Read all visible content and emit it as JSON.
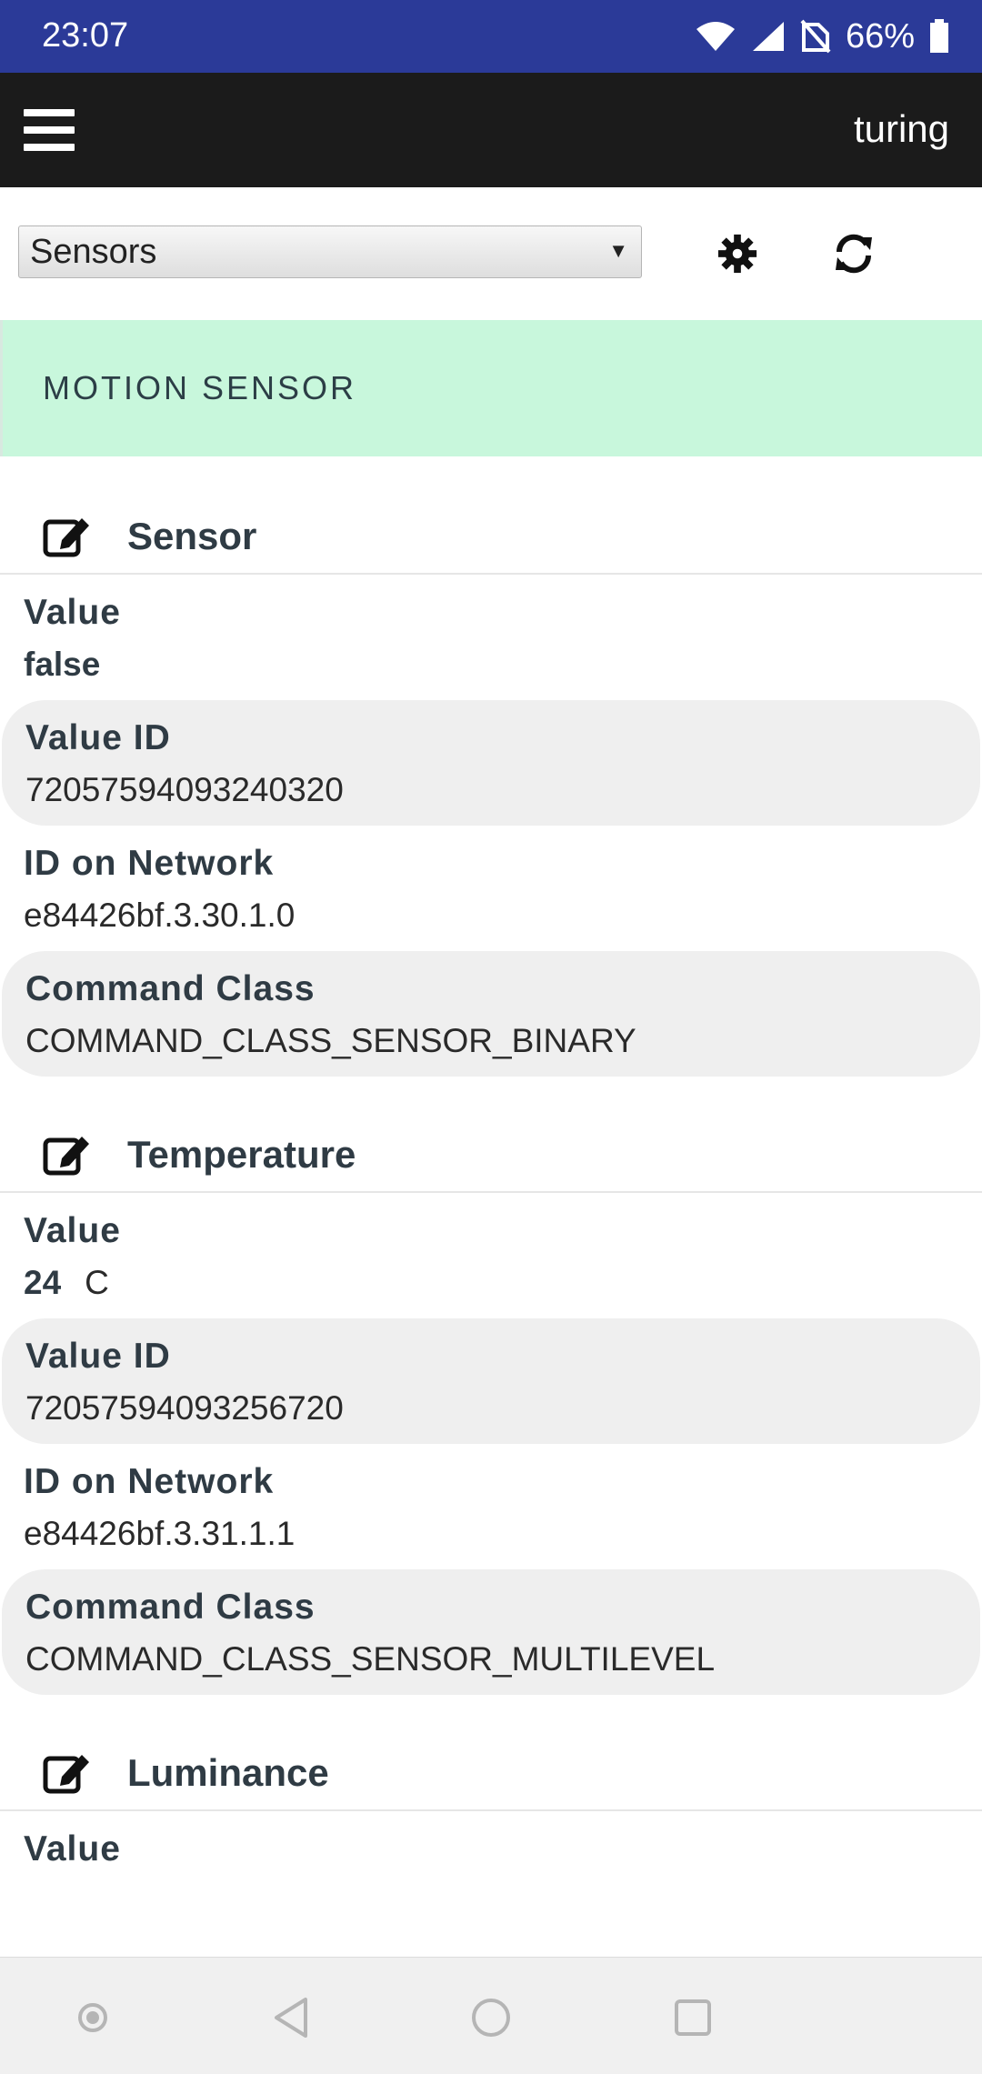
{
  "status_bar": {
    "time": "23:07",
    "battery": "66%"
  },
  "app_bar": {
    "title": "turing"
  },
  "toolbar": {
    "select_value": "Sensors",
    "select_arrow": "▼",
    "settings_icon": "gear-icon",
    "refresh_icon": "refresh-icon"
  },
  "device": {
    "name": "MOTION SENSOR"
  },
  "sections": [
    {
      "title": "Sensor",
      "value_label": "Value",
      "value": "false",
      "unit": "",
      "value_id_label": "Value ID",
      "value_id": "72057594093240320",
      "network_label": "ID on Network",
      "network_id": "e84426bf.3.30.1.0",
      "class_label": "Command Class",
      "command_class": "COMMAND_CLASS_SENSOR_BINARY"
    },
    {
      "title": "Temperature",
      "value_label": "Value",
      "value": "24",
      "unit": "C",
      "value_id_label": "Value ID",
      "value_id": "72057594093256720",
      "network_label": "ID on Network",
      "network_id": "e84426bf.3.31.1.1",
      "class_label": "Command Class",
      "command_class": "COMMAND_CLASS_SENSOR_MULTILEVEL"
    },
    {
      "title": "Luminance",
      "value_label": "Value"
    }
  ],
  "colors": {
    "status_bar": "#2b3a98",
    "app_bar": "#1b1b1b",
    "header_band": "#c8f7dc",
    "shaded_row": "#efefef"
  }
}
